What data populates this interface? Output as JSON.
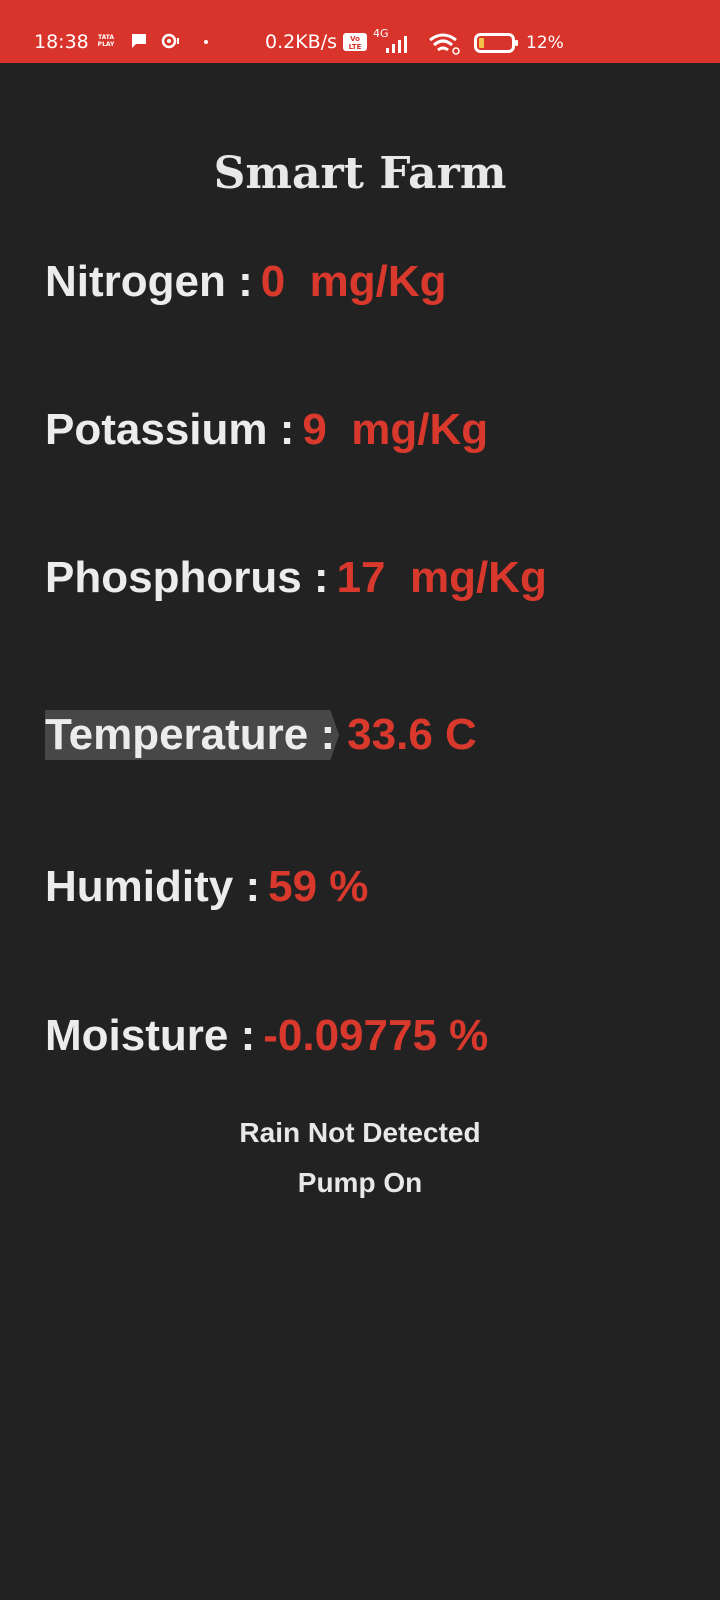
{
  "status_bar": {
    "time": "18:38",
    "tata_play": "TATA PLAY",
    "net_speed": "0.2KB/s",
    "volte_badge": "Vo LTE",
    "network_type": "4G",
    "battery": "12%",
    "icons": [
      "tata-play-icon",
      "message-icon",
      "sync-icon",
      "volte-icon",
      "signal-icon",
      "wifi-icon",
      "battery-icon"
    ]
  },
  "page": {
    "title": "Smart Farm"
  },
  "readings": [
    {
      "label": "Nitrogen :",
      "value": "0  mg/Kg"
    },
    {
      "label": "Potassium :",
      "value": "9  mg/Kg"
    },
    {
      "label": "Phosphorus :",
      "value": "17  mg/Kg"
    },
    {
      "label": "Temperature :",
      "value": "33.6 C"
    },
    {
      "label": "Humidity :",
      "value": "59 %"
    },
    {
      "label": "Moisture :",
      "value": "-0.09775 %"
    }
  ],
  "status": {
    "rain": "Rain Not Detected",
    "pump": "Pump On"
  },
  "colors": {
    "status_bar_bg": "#d9342b",
    "app_bg": "#222222",
    "value_red": "#d9392d",
    "label_text": "#ececec",
    "highlight_bg": "#474747"
  }
}
